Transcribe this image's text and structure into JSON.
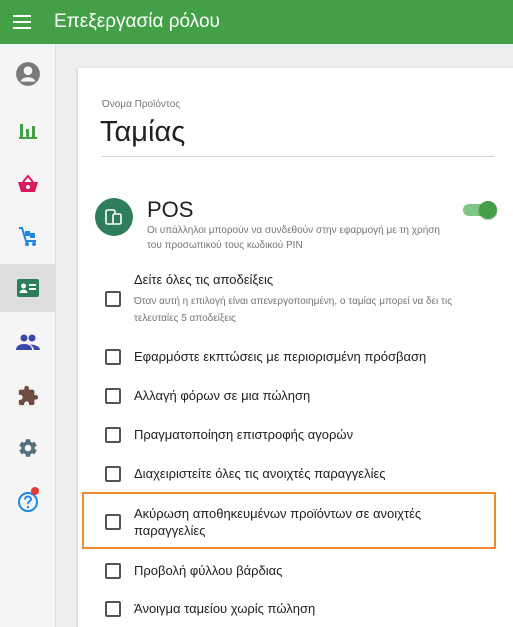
{
  "appbar": {
    "title": "Επεξεργασία ρόλου"
  },
  "sidebar": {
    "items": [
      {
        "icon": "account-circle-icon"
      },
      {
        "icon": "bar-chart-icon"
      },
      {
        "icon": "basket-icon"
      },
      {
        "icon": "cart-icon"
      },
      {
        "icon": "id-card-icon",
        "active": true
      },
      {
        "icon": "people-icon"
      },
      {
        "icon": "puzzle-icon"
      },
      {
        "icon": "gear-icon"
      },
      {
        "icon": "help-icon",
        "badge": true
      }
    ]
  },
  "form": {
    "name_label": "Όνομα Προϊόντος",
    "name_value": "Ταμίας"
  },
  "pos": {
    "title": "POS",
    "description": "Οι υπάλληλοι μπορούν να συνδεθούν στην εφαρμογή με τη χρήση του προσωπικού τους κωδικού PIN",
    "enabled": true
  },
  "permissions": [
    {
      "label": "Δείτε όλες τις αποδείξεις",
      "sub": "Όταν αυτή η επιλογή είναι απενεργοποιημένη, ο ταμίας μπορεί να δει τις τελευταίες 5 αποδείξεις",
      "checked": false
    },
    {
      "label": "Εφαρμόστε εκπτώσεις με περιορισμένη πρόσβαση",
      "checked": false
    },
    {
      "label": "Αλλαγή φόρων σε μια πώληση",
      "checked": false
    },
    {
      "label": "Πραγματοποίηση επιστροφής αγορών",
      "checked": false
    },
    {
      "label": "Διαχειριστείτε όλες τις ανοιχτές παραγγελίες",
      "checked": false
    },
    {
      "label": "Ακύρωση αποθηκευμένων προϊόντων σε ανοιχτές παραγγελίες",
      "checked": false,
      "highlighted": true
    },
    {
      "label": "Προβολή φύλλου βάρδιας",
      "checked": false
    },
    {
      "label": "Άνοιγμα ταμείου χωρίς πώληση",
      "checked": false
    }
  ],
  "colors": {
    "primary": "#43a047",
    "highlight": "#f08a2c",
    "icon": "#2e7d5b"
  }
}
